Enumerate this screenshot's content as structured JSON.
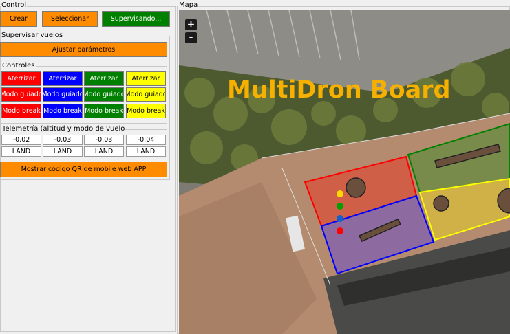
{
  "control": {
    "title": "Control",
    "crear": "Crear",
    "seleccionar": "Seleccionar",
    "supervisando": "Supervisando..."
  },
  "supervisar": {
    "title": "Supervisar vuelos",
    "ajustar": "Ajustar parámetros"
  },
  "controles": {
    "title": "Controles",
    "columns": [
      {
        "aterrizar": "Aterrizar",
        "guiado": "Modo guiado",
        "brk": "Modo break",
        "bg": "#ff0000",
        "fg": "#ffffff"
      },
      {
        "aterrizar": "Aterrizar",
        "guiado": "Modo guiado",
        "brk": "Modo break",
        "bg": "#0000ff",
        "fg": "#ffffff"
      },
      {
        "aterrizar": "Aterrizar",
        "guiado": "Modo guiado",
        "brk": "Modo break",
        "bg": "#008000",
        "fg": "#ffffff"
      },
      {
        "aterrizar": "Aterrizar",
        "guiado": "Modo guiado",
        "brk": "Modo break",
        "bg": "#ffff00",
        "fg": "#000000"
      }
    ]
  },
  "telemetria": {
    "title": "Telemetría (altitud y modo de vuelo",
    "altitudes": [
      "-0.02",
      "-0.03",
      "-0.03",
      "-0.04"
    ],
    "modes": [
      "LAND",
      "LAND",
      "LAND",
      "LAND"
    ]
  },
  "qr_button": "Mostrar código QR de mobile web APP",
  "mapa": {
    "title": "Mapa",
    "zoom_in": "+",
    "zoom_out": "-",
    "board_title": "MultiDron Board",
    "board_title_color": "#f5b000"
  },
  "colors": {
    "orange": "#ff8c00",
    "green": "#008000"
  },
  "drones": [
    {
      "name": "drone-yellow",
      "color": "#ffd800"
    },
    {
      "name": "drone-green",
      "color": "#00a000"
    },
    {
      "name": "drone-blue",
      "color": "#1060d0"
    },
    {
      "name": "drone-red",
      "color": "#ff0000"
    }
  ]
}
